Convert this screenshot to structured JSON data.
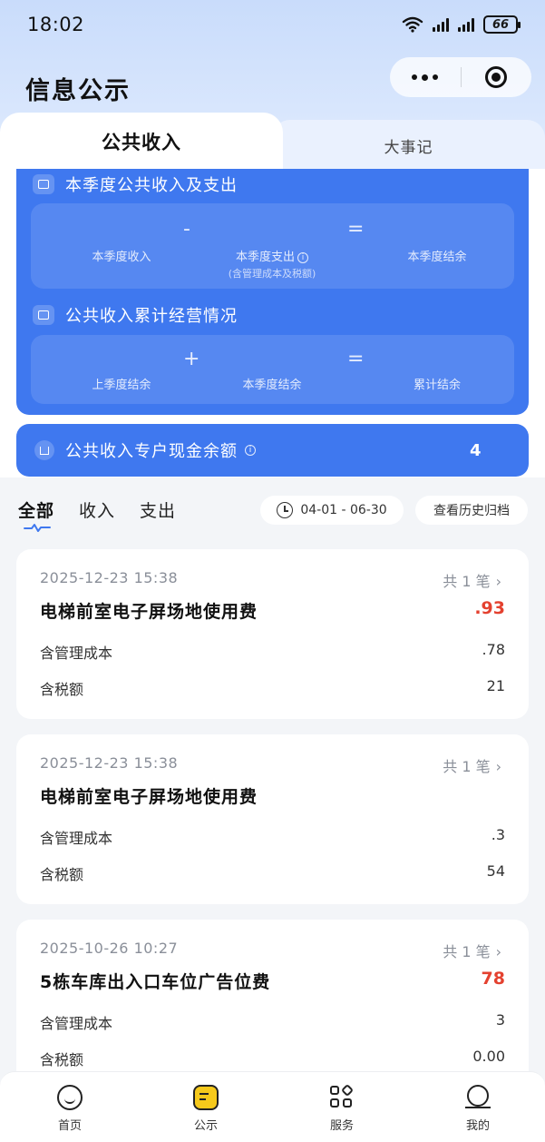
{
  "status_bar": {
    "time": "18:02",
    "battery": "66"
  },
  "header": {
    "title": "信息公示"
  },
  "tabs": [
    {
      "label": "公共收入"
    },
    {
      "label": "大事记"
    }
  ],
  "quarter_summary": {
    "title": "本季度公共收入及支出",
    "income_value": "",
    "income_label": "本季度收入",
    "op_minus": "-",
    "expense_value": "",
    "expense_label": "本季度支出",
    "expense_note": "(含管理成本及税额)",
    "op_equals": "=",
    "balance_value": "",
    "balance_label": "本季度结余"
  },
  "cumulative": {
    "title": "公共收入累计经营情况",
    "prev_value": "",
    "prev_label": "上季度结余",
    "op_plus": "+",
    "current_value": "",
    "current_label": "本季度结余",
    "op_equals": "=",
    "total_value": "",
    "total_label": "累计结余"
  },
  "cash_balance": {
    "label": "公共收入专户现金余额",
    "value_suffix": "4"
  },
  "filters": {
    "tabs": [
      {
        "label": "全部"
      },
      {
        "label": "收入"
      },
      {
        "label": "支出"
      }
    ],
    "date_range": "04-01 - 06-30",
    "history_button": "查看历史归档"
  },
  "records": [
    {
      "datetime": "2025-12-23 15:38",
      "count_label": "共 1 笔",
      "title": "电梯前室电子屏场地使用费",
      "amount": ".93",
      "mgmt_label": "含管理成本",
      "mgmt_value": ".78",
      "tax_label": "含税额",
      "tax_value": "21"
    },
    {
      "datetime": "2025-12-23 15:38",
      "count_label": "共 1 笔",
      "title": "电梯前室电子屏场地使用费",
      "amount": "",
      "mgmt_label": "含管理成本",
      "mgmt_value": ".3",
      "tax_label": "含税额",
      "tax_value": "54"
    },
    {
      "datetime": "2025-10-26 10:27",
      "count_label": "共 1 笔",
      "title": "5栋车库出入口车位广告位费",
      "amount": "78",
      "mgmt_label": "含管理成本",
      "mgmt_value": "3",
      "tax_label": "含税额",
      "tax_value": "0.00"
    }
  ],
  "bottom_nav": [
    {
      "label": "首页"
    },
    {
      "label": "公示"
    },
    {
      "label": "服务"
    },
    {
      "label": "我的"
    }
  ],
  "colors": {
    "primary": "#3f78ef",
    "amount_red": "#e4412f",
    "nav_active": "#f6c91b"
  }
}
